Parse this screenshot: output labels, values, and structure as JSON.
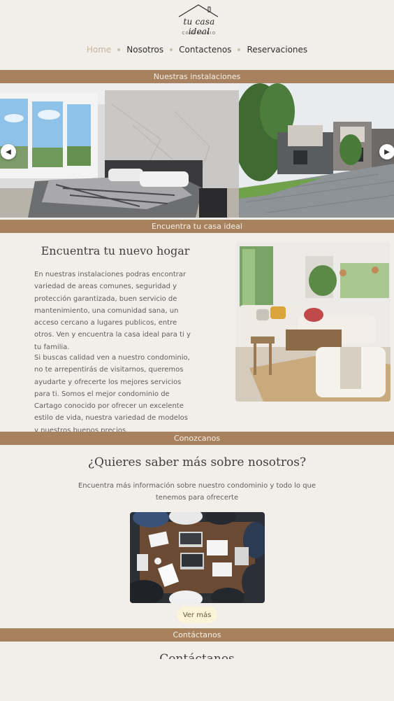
{
  "logo": {
    "name": "tu casa ideal",
    "subtitle": "CONDOMINIO"
  },
  "nav": {
    "items": [
      {
        "label": "Home",
        "active": true
      },
      {
        "label": "Nosotros",
        "active": false
      },
      {
        "label": "Contactenos",
        "active": false
      },
      {
        "label": "Reservaciones",
        "active": false
      }
    ]
  },
  "sections": {
    "instalaciones": "Nuestras instalaciones",
    "encuentra": "Encuentra tu casa ideal",
    "conozcanos": "Conozcanos",
    "contactanos": "Contáctanos"
  },
  "carousel": {
    "prev_icon": "chevron-left-icon",
    "next_icon": "chevron-right-icon"
  },
  "hogar": {
    "title": "Encuentra tu nuevo hogar",
    "para1": "En nuestras instalaciones podras encontrar variedad de areas comunes, seguridad y protección garantizada, buen servicio de mantenimiento, una comunidad sana, un acceso cercano a lugares publicos, entre otros. Ven y encuentra la casa ideal para ti y tu familia.",
    "para2": "Si buscas calidad ven a nuestro condominio, no te arrepentirás de visitarnos, queremos ayudarte y ofrecerte los mejores servicios para ti. Somos el mejor condominio de Cartago conocido por ofrecer un excelente estilo de vida, nuestra variedad de modelos y nuestros buenos precios."
  },
  "nosotros": {
    "title": "¿Quieres saber más sobre nosotros?",
    "description": "Encuentra más información sobre nuestro condominio y todo lo que tenemos para ofrecerte",
    "button": "Ver más"
  },
  "contacto": {
    "title": "Contáctanos"
  },
  "colors": {
    "background": "#f2efeb",
    "bar": "#a8825e",
    "nav_active": "#c9b59a",
    "button_bg": "#fbf3da"
  }
}
